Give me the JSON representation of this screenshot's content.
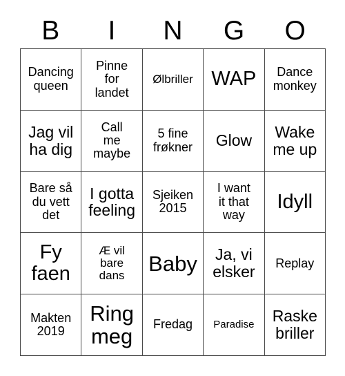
{
  "card": {
    "title": "BINGO",
    "header_letters": [
      "B",
      "I",
      "N",
      "G",
      "O"
    ],
    "grid_size": "5x5",
    "colors": {
      "background": "#ffffff",
      "text": "#000000",
      "border": "#4a4a4a"
    }
  },
  "cells": [
    {
      "text": "Dancing\nqueen",
      "size": "fs-sm",
      "column": "B",
      "row": 1
    },
    {
      "text": "Pinne\nfor\nlandet",
      "size": "fs-sm",
      "column": "I",
      "row": 1
    },
    {
      "text": "Ølbriller",
      "size": "fs-xs",
      "column": "N",
      "row": 1
    },
    {
      "text": "WAP",
      "size": "fs-lg",
      "column": "G",
      "row": 1
    },
    {
      "text": "Dance\nmonkey",
      "size": "fs-sm",
      "column": "O",
      "row": 1
    },
    {
      "text": "Jag vil\nha dig",
      "size": "fs-md",
      "column": "B",
      "row": 2
    },
    {
      "text": "Call\nme\nmaybe",
      "size": "fs-sm",
      "column": "I",
      "row": 2
    },
    {
      "text": "5 fine\nfrøkner",
      "size": "fs-sm",
      "column": "N",
      "row": 2
    },
    {
      "text": "Glow",
      "size": "fs-md",
      "column": "G",
      "row": 2
    },
    {
      "text": "Wake\nme up",
      "size": "fs-md",
      "column": "O",
      "row": 2
    },
    {
      "text": "Bare så\ndu vett\ndet",
      "size": "fs-sm",
      "column": "B",
      "row": 3
    },
    {
      "text": "I gotta\nfeeling",
      "size": "fs-md",
      "column": "I",
      "row": 3
    },
    {
      "text": "Sjeiken\n2015",
      "size": "fs-sm",
      "column": "N",
      "row": 3
    },
    {
      "text": "I want\nit that\nway",
      "size": "fs-sm",
      "column": "G",
      "row": 3
    },
    {
      "text": "Idyll",
      "size": "fs-lg",
      "column": "O",
      "row": 3
    },
    {
      "text": "Fy\nfaen",
      "size": "fs-lg",
      "column": "B",
      "row": 4
    },
    {
      "text": "Æ vil\nbare\ndans",
      "size": "fs-xs",
      "column": "I",
      "row": 4
    },
    {
      "text": "Baby",
      "size": "fs-xl",
      "column": "N",
      "row": 4
    },
    {
      "text": "Ja, vi\nelsker",
      "size": "fs-md",
      "column": "G",
      "row": 4
    },
    {
      "text": "Replay",
      "size": "fs-sm",
      "column": "O",
      "row": 4
    },
    {
      "text": "Makten\n2019",
      "size": "fs-sm",
      "column": "B",
      "row": 5
    },
    {
      "text": "Ring\nmeg",
      "size": "fs-xl",
      "column": "I",
      "row": 5
    },
    {
      "text": "Fredag",
      "size": "fs-sm",
      "column": "N",
      "row": 5
    },
    {
      "text": "Paradise",
      "size": "fs-xxs",
      "column": "G",
      "row": 5
    },
    {
      "text": "Raske\nbriller",
      "size": "fs-md",
      "column": "O",
      "row": 5
    }
  ]
}
